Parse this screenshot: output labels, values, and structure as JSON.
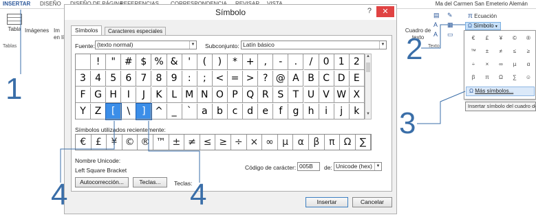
{
  "ribbon": {
    "tabs": [
      "INSERTAR",
      "DISEÑO",
      "DISEÑO DE PÁGINA",
      "REFERENCIAS",
      "CORRESPONDENCIA",
      "REVISAR",
      "VISTA"
    ],
    "user": "Ma del Carmen San Emeterio Alemán",
    "tabla_label": "Tabla",
    "tablas_group": "Tablas",
    "imagenes_label": "Imágenes",
    "imagenes_sub": "Im",
    "en_linea": "en lí",
    "cuadro_label": "Cuadro de texto",
    "texto_group": "Texto",
    "ecuacion_label": "Ecuación",
    "simbolo_label": "Símbolo"
  },
  "dropdown": {
    "symbols": [
      "€",
      "£",
      "¥",
      "©",
      "®",
      "™",
      "±",
      "≠",
      "≤",
      "≥",
      "÷",
      "×",
      "∞",
      "µ",
      "α",
      "β",
      "π",
      "Ω",
      "∑",
      "☺"
    ],
    "more_symbols": "Más símbolos...",
    "tooltip": "Insertar símbolo del cuadro de diálogo"
  },
  "dialog": {
    "title": "Símbolo",
    "help": "?",
    "close": "✕",
    "tab_symbols": "Símbolos",
    "tab_special": "Caracteres especiales",
    "font_label": "Fuente:",
    "font_value": "(texto normal)",
    "subset_label": "Subconjunto:",
    "subset_value": "Latín básico",
    "grid": [
      [
        "",
        "!",
        "\"",
        "#",
        "$",
        "%",
        "&",
        "'",
        "(",
        ")",
        "*",
        "+",
        ",",
        "-",
        ".",
        "/",
        "0",
        "1",
        "2"
      ],
      [
        "3",
        "4",
        "5",
        "6",
        "7",
        "8",
        "9",
        ":",
        ";",
        "<",
        "=",
        ">",
        "?",
        "@",
        "A",
        "B",
        "C",
        "D",
        "E"
      ],
      [
        "F",
        "G",
        "H",
        "I",
        "J",
        "K",
        "L",
        "M",
        "N",
        "O",
        "P",
        "Q",
        "R",
        "S",
        "T",
        "U",
        "V",
        "W",
        "X"
      ],
      [
        "Y",
        "Z",
        "[",
        "\\",
        "]",
        "^",
        "_",
        "`",
        "a",
        "b",
        "c",
        "d",
        "e",
        "f",
        "g",
        "h",
        "i",
        "j",
        "k"
      ]
    ],
    "recent_label": "Símbolos utilizados recientemente:",
    "recent": [
      "€",
      "£",
      "¥",
      "©",
      "®",
      "™",
      "±",
      "≠",
      "≤",
      "≥",
      "÷",
      "×",
      "∞",
      "µ",
      "α",
      "β",
      "π",
      "Ω",
      "∑"
    ],
    "unicode_name_label": "Nombre Unicode:",
    "unicode_name": "Left Square Bracket",
    "char_code_label": "Código de carácter:",
    "char_code": "005B",
    "from_label": "de:",
    "from_value": "Unicode (hex)",
    "autocorrect_button": "Autocorrección...",
    "keys_button": "Teclas...",
    "keys_label": "Teclas:",
    "insert_button": "Insertar",
    "cancel_button": "Cancelar"
  },
  "annotations": [
    "1",
    "2",
    "3",
    "4",
    "4"
  ]
}
